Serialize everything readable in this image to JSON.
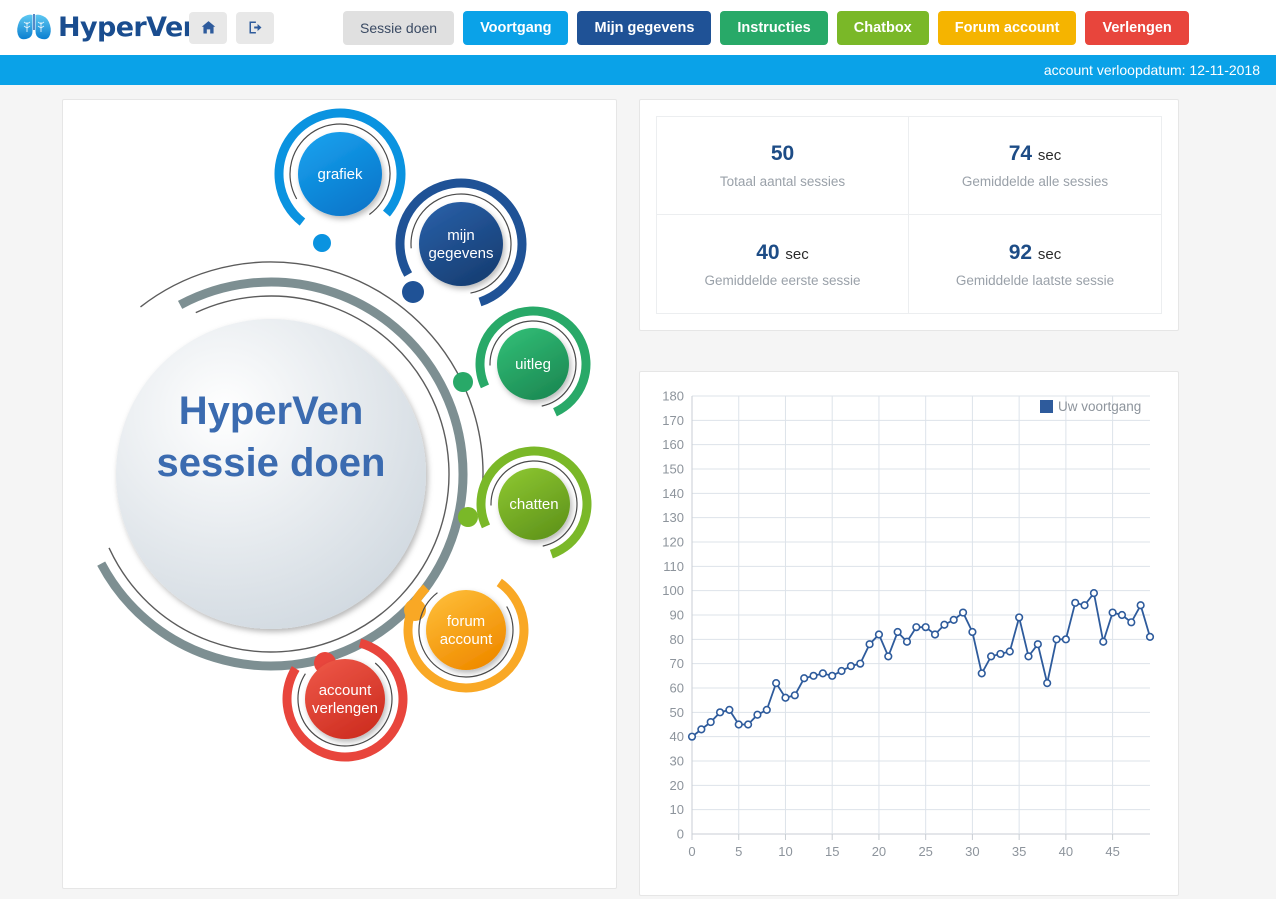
{
  "header": {
    "logo_text": "HyperVen",
    "logo_icon": "lungs-icon",
    "home_icon": "home-icon",
    "logout_icon": "logout-icon",
    "nav": [
      {
        "label": "Sessie doen",
        "color": "#e0e0e0",
        "active": false
      },
      {
        "label": "Voortgang",
        "color": "#0aa2e8",
        "active": true
      },
      {
        "label": "Mijn gegevens",
        "color": "#1f5296",
        "active": true
      },
      {
        "label": "Instructies",
        "color": "#28a968",
        "active": true
      },
      {
        "label": "Chatbox",
        "color": "#7ab828",
        "active": true
      },
      {
        "label": "Forum account",
        "color": "#f5b400",
        "active": true
      },
      {
        "label": "Verlengen",
        "color": "#e8453c",
        "active": true
      }
    ]
  },
  "expiry_bar": {
    "text": "account verloopdatum: 12-11-2018",
    "background": "#0aa2e8"
  },
  "stats": [
    {
      "value": "50",
      "unit": "",
      "label": "Totaal aantal sessies"
    },
    {
      "value": "74",
      "unit": "sec",
      "label": "Gemiddelde alle sessies"
    },
    {
      "value": "40",
      "unit": "sec",
      "label": "Gemiddelde eerste sessie"
    },
    {
      "value": "92",
      "unit": "sec",
      "label": "Gemiddelde laatste sessie"
    }
  ],
  "diagram": {
    "center_line1": "HyperVen",
    "center_line2": "sessie doen",
    "nodes": [
      {
        "id": "grafiek",
        "label_line1": "grafiek",
        "label_line2": "",
        "color": "#0a93e0"
      },
      {
        "id": "mijn-gegevens",
        "label_line1": "mijn",
        "label_line2": "gegevens",
        "color": "#1f5296"
      },
      {
        "id": "uitleg",
        "label_line1": "uitleg",
        "label_line2": "",
        "color": "#28a968"
      },
      {
        "id": "chatten",
        "label_line1": "chatten",
        "label_line2": "",
        "color": "#7ab828"
      },
      {
        "id": "forum-account",
        "label_line1": "forum",
        "label_line2": "account",
        "color": "#f9a825"
      },
      {
        "id": "account-verlengen",
        "label_line1": "account",
        "label_line2": "verlengen",
        "color": "#e8453c"
      }
    ]
  },
  "chart_data": {
    "type": "line",
    "title": "",
    "xlabel": "",
    "ylabel": "",
    "xlim": [
      0,
      49
    ],
    "ylim": [
      0,
      180
    ],
    "xticks": [
      0,
      5,
      10,
      15,
      20,
      25,
      30,
      35,
      40,
      45
    ],
    "yticks": [
      0,
      10,
      20,
      30,
      40,
      50,
      60,
      70,
      80,
      90,
      100,
      110,
      120,
      130,
      140,
      150,
      160,
      170,
      180
    ],
    "grid": true,
    "legend_position": "top-right",
    "series": [
      {
        "name": "Uw voortgang",
        "color": "#2e5b9c",
        "marker": "open-circle",
        "x": [
          0,
          1,
          2,
          3,
          4,
          5,
          6,
          7,
          8,
          9,
          10,
          11,
          12,
          13,
          14,
          15,
          16,
          17,
          18,
          19,
          20,
          21,
          22,
          23,
          24,
          25,
          26,
          27,
          28,
          29,
          30,
          31,
          32,
          33,
          34,
          35,
          36,
          37,
          38,
          39,
          40,
          41,
          42,
          43,
          44,
          45,
          46,
          47,
          48,
          49
        ],
        "values": [
          40,
          43,
          46,
          50,
          51,
          45,
          45,
          49,
          51,
          62,
          56,
          57,
          64,
          65,
          66,
          65,
          67,
          69,
          70,
          78,
          82,
          73,
          83,
          79,
          85,
          85,
          82,
          86,
          88,
          91,
          83,
          66,
          73,
          74,
          75,
          89,
          73,
          78,
          62,
          80,
          80,
          95,
          94,
          99,
          79,
          91,
          90,
          87,
          94,
          81
        ]
      }
    ]
  }
}
